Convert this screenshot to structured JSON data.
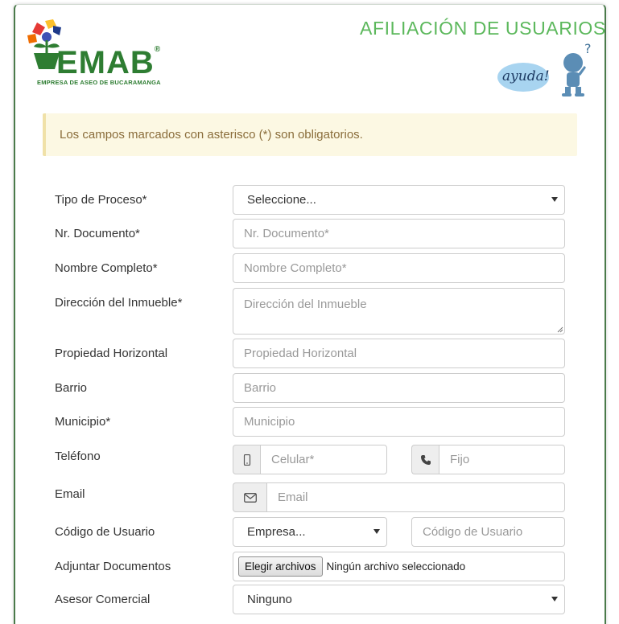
{
  "header": {
    "logo_word": "EMAB",
    "logo_reg": "®",
    "logo_subtitle": "EMPRESA DE ASEO DE BUCARAMANGA",
    "title": "AFILIACIÓN DE USUARIOS",
    "help_label": "ayuda!"
  },
  "alert": {
    "text": "Los campos marcados con asterisco (*) son obligatorios."
  },
  "form": {
    "tipo_proceso": {
      "label": "Tipo de Proceso*",
      "selected": "Seleccione..."
    },
    "documento": {
      "label": "Nr. Documento*",
      "placeholder": "Nr. Documento*"
    },
    "nombre": {
      "label": "Nombre Completo*",
      "placeholder": "Nombre Completo*"
    },
    "direccion": {
      "label": "Dirección del Inmueble*",
      "placeholder": "Dirección del Inmueble"
    },
    "propiedad": {
      "label": "Propiedad Horizontal",
      "placeholder": "Propiedad Horizontal"
    },
    "barrio": {
      "label": "Barrio",
      "placeholder": "Barrio"
    },
    "municipio": {
      "label": "Municipio*",
      "placeholder": "Municipio"
    },
    "telefono": {
      "label": "Teléfono",
      "celular_placeholder": "Celular*",
      "fijo_placeholder": "Fijo"
    },
    "email": {
      "label": "Email",
      "placeholder": "Email"
    },
    "codigo": {
      "label": "Código de Usuario",
      "empresa_selected": "Empresa...",
      "placeholder": "Código de Usuario"
    },
    "adjuntar": {
      "label": "Adjuntar Documentos",
      "button": "Elegir archivos",
      "status": "Ningún archivo seleccionado"
    },
    "asesor": {
      "label": "Asesor Comercial",
      "selected": "Ninguno"
    }
  },
  "colors": {
    "brand_green": "#2e7d32",
    "title_green": "#5cb85c",
    "alert_bg": "#fcf8e3",
    "alert_text": "#8a6d3b"
  },
  "icons": {
    "mobile": "mobile-phone-icon",
    "phone": "phone-icon",
    "envelope": "envelope-icon"
  }
}
